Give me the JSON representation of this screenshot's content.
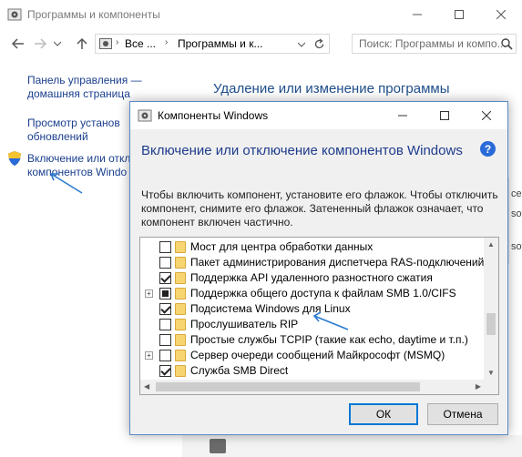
{
  "colors": {
    "link": "#1a3f8e",
    "heading": "#1e4e8c",
    "dialog_border": "#5a8ac6",
    "annotation": "#2a7ad0"
  },
  "control_panel": {
    "title": "Программы и компоненты",
    "address": {
      "root": "Все ...",
      "path": "Программы и к..."
    },
    "search_placeholder": "Поиск: Программы и компо...",
    "sidebar": [
      {
        "line1": "Панель управления —",
        "line2": "домашняя страница"
      },
      {
        "line1": "Просмотр установ",
        "line2": "обновлений"
      },
      {
        "line1": "Включение или откл",
        "line2": "компонентов Windo"
      }
    ],
    "heading": "Удаление или изменение программы",
    "right_edge_fragments": [
      "ces",
      "soft",
      "soft"
    ]
  },
  "dialog": {
    "title": "Компоненты Windows",
    "heading": "Включение или отключение компонентов Windows",
    "description": "Чтобы включить компонент, установите его флажок. Чтобы отключить компонент, снимите его флажок. Затененный флажок означает, что компонент включен частично.",
    "items": [
      {
        "label": "Мост для центра обработки данных",
        "state": "unchecked",
        "expandable": false
      },
      {
        "label": "Пакет администрирования диспетчера RAS-подключений",
        "state": "unchecked",
        "expandable": false
      },
      {
        "label": "Поддержка API удаленного разностного сжатия",
        "state": "checked",
        "expandable": false
      },
      {
        "label": "Поддержка общего доступа к файлам SMB 1.0/CIFS",
        "state": "partial",
        "expandable": true
      },
      {
        "label": "Подсистема Windows для Linux",
        "state": "checked",
        "expandable": false
      },
      {
        "label": "Прослушиватель RIP",
        "state": "unchecked",
        "expandable": false
      },
      {
        "label": "Простые службы TCPIP (такие как echo, daytime и т.п.)",
        "state": "unchecked",
        "expandable": false
      },
      {
        "label": "Сервер очереди сообщений Майкрософт (MSMQ)",
        "state": "unchecked",
        "expandable": true
      },
      {
        "label": "Служба SMB Direct",
        "state": "checked",
        "expandable": false
      }
    ],
    "ok_label": "ОК",
    "cancel_label": "Отмена"
  }
}
